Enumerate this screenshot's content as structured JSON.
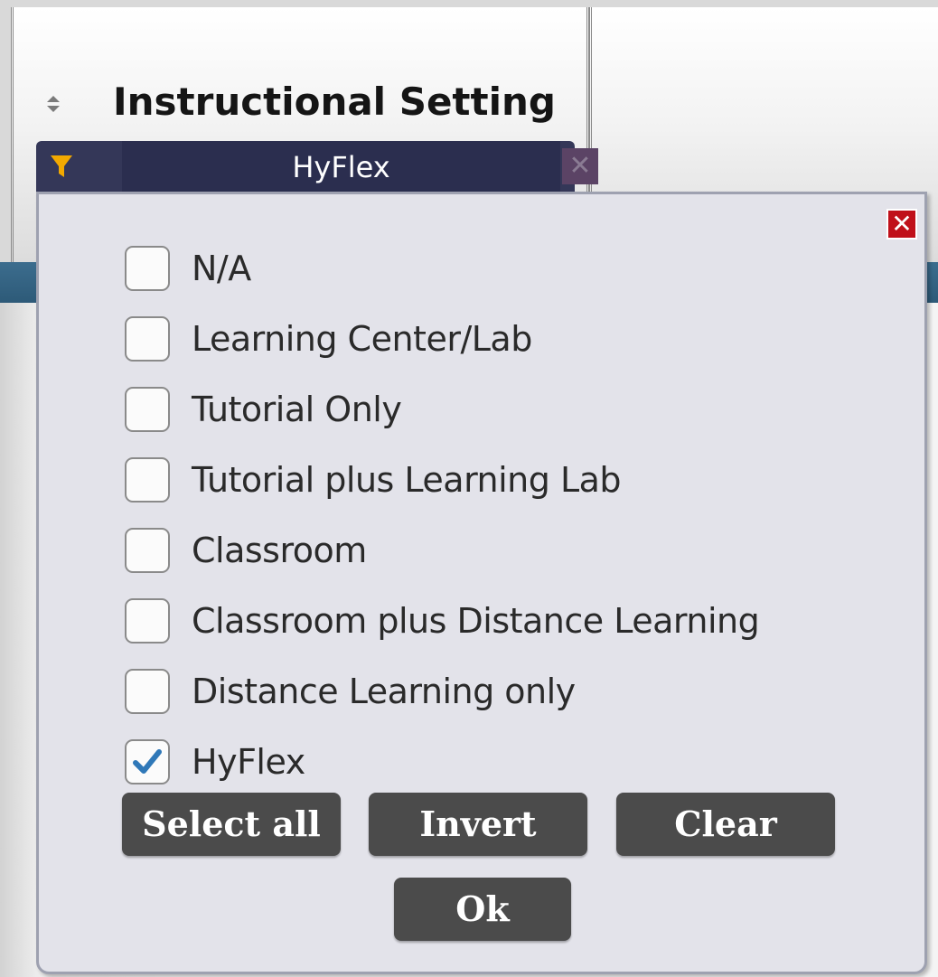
{
  "column_header": {
    "title": "Instructional Setting",
    "sort_icon": "sort-arrows-icon"
  },
  "filter": {
    "value": "HyFlex",
    "filter_icon": "funnel-icon",
    "clear_icon": "x-icon",
    "accent_color": "#f2a900"
  },
  "popup": {
    "close_icon": "close-icon",
    "options": [
      {
        "label": "N/A",
        "checked": false
      },
      {
        "label": "Learning Center/Lab",
        "checked": false
      },
      {
        "label": "Tutorial Only",
        "checked": false
      },
      {
        "label": "Tutorial plus Learning Lab",
        "checked": false
      },
      {
        "label": "Classroom",
        "checked": false
      },
      {
        "label": "Classroom plus Distance Learning",
        "checked": false
      },
      {
        "label": "Distance Learning only",
        "checked": false
      },
      {
        "label": "HyFlex",
        "checked": true
      }
    ],
    "buttons": {
      "select_all": "Select all",
      "invert": "Invert",
      "clear": "Clear",
      "ok": "Ok"
    }
  }
}
